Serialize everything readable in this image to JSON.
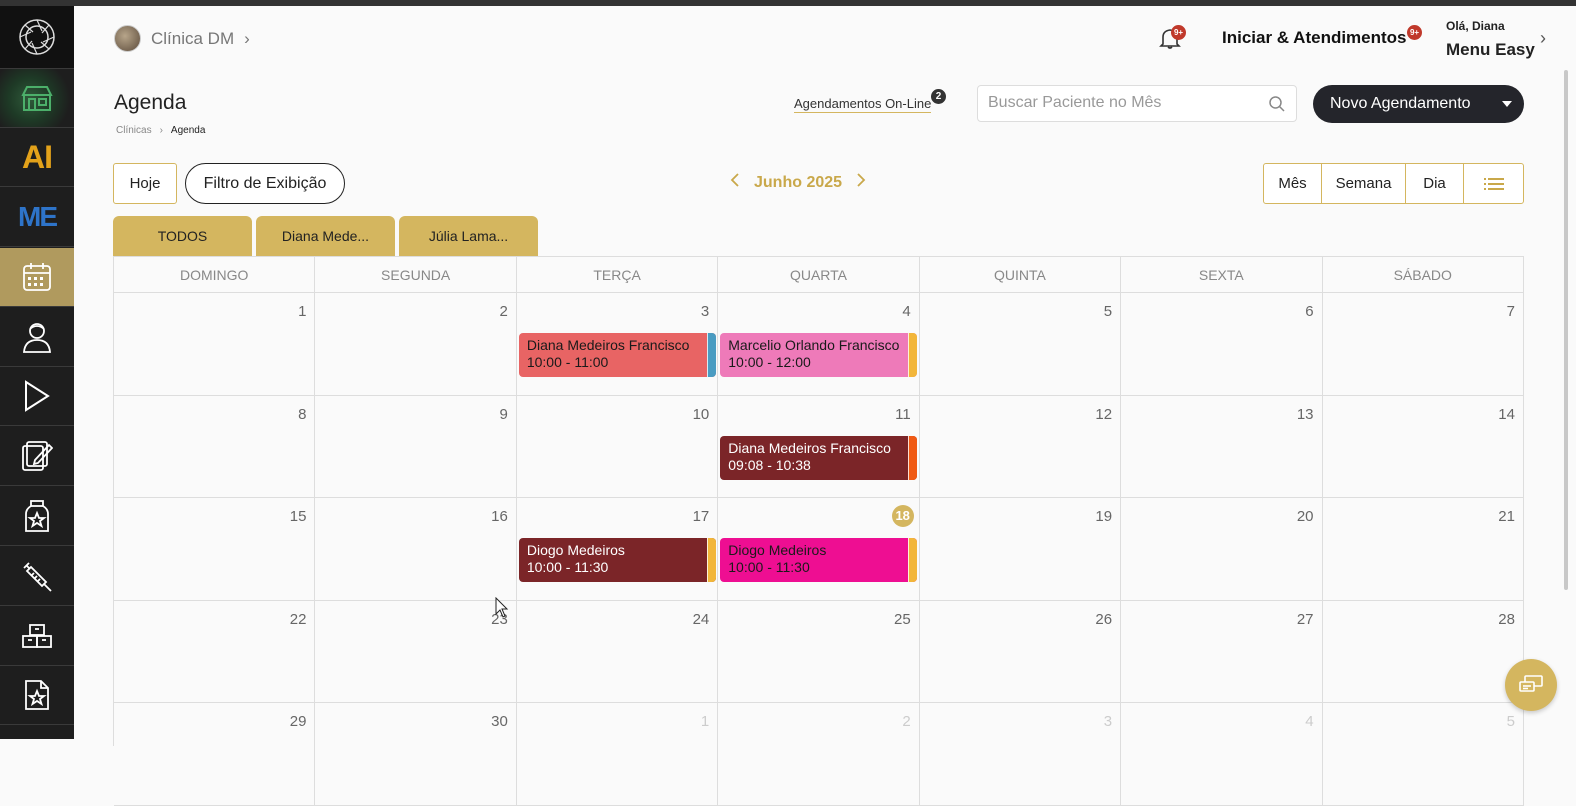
{
  "header": {
    "clinic_name": "Clínica DM",
    "clinic_chevron": "›",
    "notif_badge": "9+",
    "iniciar_label": "Iniciar & Atendimentos",
    "iniciar_badge": "9+",
    "greeting": "Olá, Diana",
    "menu_label": "Menu Easy",
    "menu_chevron": "›"
  },
  "sidebar": {
    "items": [
      {
        "icon": "logo-icon"
      },
      {
        "icon": "store-icon"
      },
      {
        "icon": "ai-icon",
        "text": "AI"
      },
      {
        "icon": "me-icon",
        "text": "ME"
      },
      {
        "icon": "calendar-icon",
        "active": true
      },
      {
        "icon": "patient-icon"
      },
      {
        "icon": "play-icon"
      },
      {
        "icon": "records-icon"
      },
      {
        "icon": "medicine-icon"
      },
      {
        "icon": "syringe-icon"
      },
      {
        "icon": "boxes-icon"
      },
      {
        "icon": "certificate-icon"
      }
    ]
  },
  "page": {
    "title": "Agenda",
    "breadcrumb": [
      "Clínicas",
      "›",
      "Agenda"
    ],
    "online_label": "Agendamentos On-Line",
    "online_count": "2",
    "search_placeholder": "Buscar Paciente no Mês",
    "new_button": "Novo Agendamento"
  },
  "controls": {
    "today": "Hoje",
    "filter": "Filtro de Exibição",
    "month": "Junho 2025",
    "prev": "‹",
    "next": "›",
    "views": [
      "Mês",
      "Semana",
      "Dia"
    ]
  },
  "tabs": [
    "TODOS",
    "Diana Mede...",
    "Júlia Lama..."
  ],
  "calendar": {
    "weekdays": [
      "DOMINGO",
      "SEGUNDA",
      "TERÇA",
      "QUARTA",
      "QUINTA",
      "SEXTA",
      "SÁBADO"
    ],
    "weeks": [
      [
        "1",
        "2",
        "3",
        "4",
        "5",
        "6",
        "7"
      ],
      [
        "8",
        "9",
        "10",
        "11",
        "12",
        "13",
        "14"
      ],
      [
        "15",
        "16",
        "17",
        "18",
        "19",
        "20",
        "21"
      ],
      [
        "22",
        "23",
        "24",
        "25",
        "26",
        "27",
        "28"
      ],
      [
        "29",
        "30",
        "1",
        "2",
        "3",
        "4",
        "5"
      ]
    ],
    "today": "18",
    "events": [
      {
        "week": 0,
        "day": 2,
        "title": "Diana Medeiros Francisco",
        "time": "10:00 - 11:00",
        "bg": "#e86464",
        "text": "#1a1a1a",
        "strip": "#4a9cc2"
      },
      {
        "week": 0,
        "day": 3,
        "title": "Marcelio Orlando Francisco",
        "time": "10:00 - 12:00",
        "bg": "#ee7ab9",
        "text": "#1a1a1a",
        "strip": "#f2b63a"
      },
      {
        "week": 1,
        "day": 3,
        "title": "Diana Medeiros Francisco",
        "time": "09:08 - 10:38",
        "bg": "#7b2528",
        "text": "#ffffff",
        "strip": "#f05a14"
      },
      {
        "week": 2,
        "day": 2,
        "title": "Diogo Medeiros",
        "time": "10:00 - 11:30",
        "bg": "#7b2528",
        "text": "#ffffff",
        "strip": "#f2b63a"
      },
      {
        "week": 2,
        "day": 3,
        "title": "Diogo Medeiros",
        "time": "10:00 - 11:30",
        "bg": "#ee0e92",
        "text": "#1a1a1a",
        "strip": "#f2b63a"
      }
    ]
  },
  "colors": {
    "accent_gold": "#d4b65f",
    "sidebar_bg": "#1e1e1e",
    "dark_button": "#24252b"
  }
}
